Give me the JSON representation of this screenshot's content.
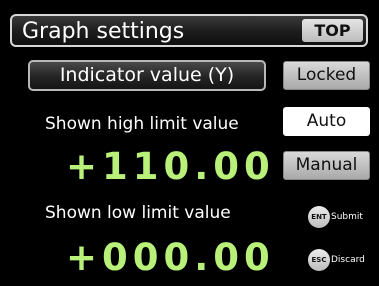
{
  "header": {
    "title": "Graph settings",
    "top_button": "TOP"
  },
  "indicator": {
    "value": "Indicator value (Y)"
  },
  "mode_buttons": {
    "locked": "Locked",
    "auto": "Auto",
    "manual": "Manual",
    "selected": "Auto"
  },
  "high_limit": {
    "label": "Shown high limit value",
    "value": "+110.00"
  },
  "low_limit": {
    "label": "Shown low limit value",
    "value": "+000.00"
  },
  "key_hints": {
    "submit_key": "ENT",
    "submit_label": "Submit",
    "discard_key": "ESC",
    "discard_label": "Discard"
  },
  "colors": {
    "value_green": "#b8f079",
    "background": "#000000"
  }
}
